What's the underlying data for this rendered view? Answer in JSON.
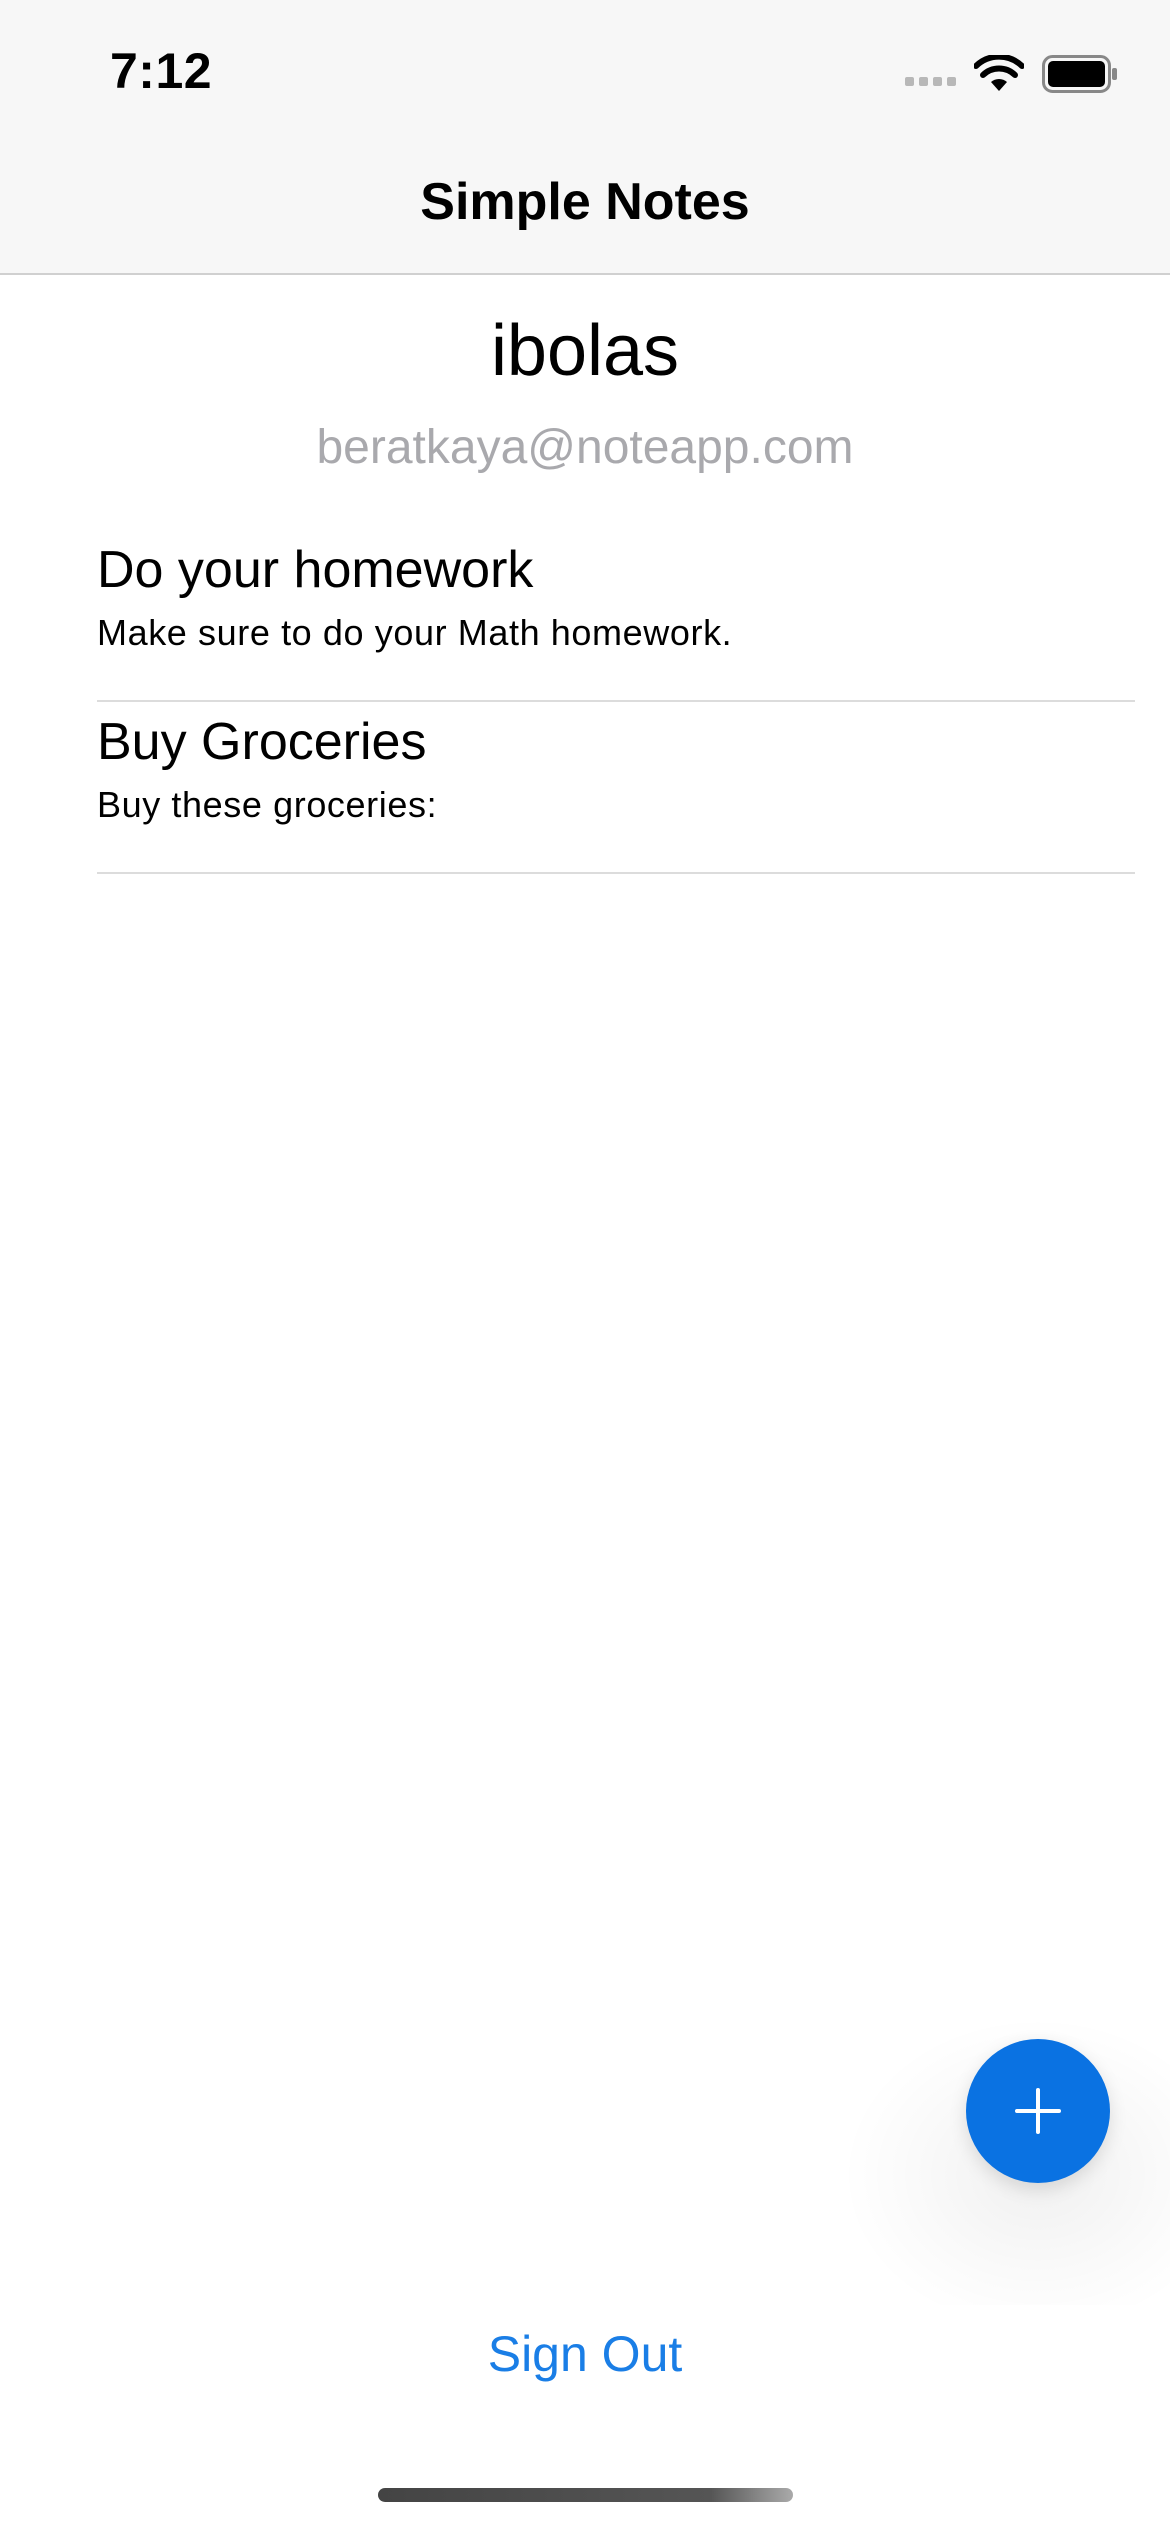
{
  "status_bar": {
    "time": "7:12",
    "icons": [
      "cellular-signal-icon",
      "wifi-icon",
      "battery-icon"
    ]
  },
  "nav": {
    "title": "Simple Notes"
  },
  "profile": {
    "username": "ibolas",
    "email": "beratkaya@noteapp.com"
  },
  "notes": [
    {
      "title": "Do your homework",
      "body": "Make sure to do your Math homework."
    },
    {
      "title": "Buy Groceries",
      "body": "Buy these groceries:"
    }
  ],
  "fab": {
    "icon": "plus-icon",
    "color": "#0a72e2"
  },
  "sign_out": {
    "label": "Sign Out",
    "color": "#1a7ee6"
  }
}
